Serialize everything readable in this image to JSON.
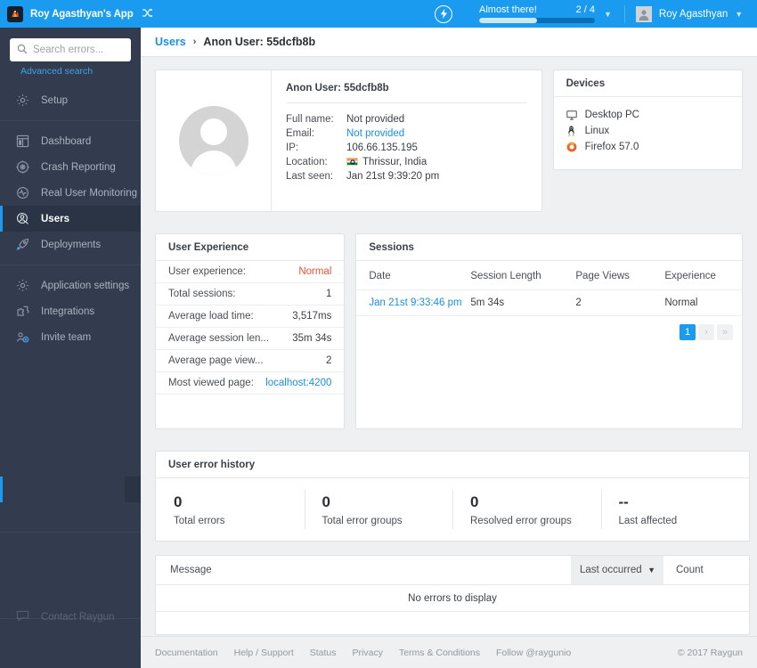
{
  "topbar": {
    "logo_icon": "app-logo-icon",
    "app_name": "Roy Agasthyan's App",
    "switch_icon": "shuffle-icon",
    "bolt_icon": "bolt-circle-icon",
    "onboarding": {
      "label": "Almost there!",
      "count": "2 / 4",
      "progress_percent": 50,
      "caret_icon": "caret-down-icon"
    },
    "user": {
      "avatar_icon": "user-avatar-icon",
      "name": "Roy Agasthyan",
      "caret_icon": "caret-down-icon"
    }
  },
  "sidebar": {
    "search": {
      "icon": "search-icon",
      "placeholder": "Search errors...",
      "value": ""
    },
    "advanced_search": "Advanced search",
    "items": [
      {
        "label": "Setup",
        "icon": "gear-icon",
        "active": false
      },
      {
        "label": "Dashboard",
        "icon": "dashboard-icon",
        "active": false
      },
      {
        "label": "Crash Reporting",
        "icon": "target-icon",
        "active": false
      },
      {
        "label": "Real User Monitoring",
        "icon": "pulse-icon",
        "active": false
      },
      {
        "label": "Users",
        "icon": "user-search-icon",
        "active": true
      },
      {
        "label": "Deployments",
        "icon": "rocket-icon",
        "active": false
      },
      {
        "label": "Application settings",
        "icon": "gear-icon",
        "active": false
      },
      {
        "label": "Integrations",
        "icon": "puzzle-icon",
        "active": false
      },
      {
        "label": "Invite team",
        "icon": "add-user-icon",
        "active": false
      }
    ],
    "contact": {
      "label": "Contact Raygun",
      "icon": "chat-icon"
    }
  },
  "breadcrumb": {
    "parent": "Users",
    "separator": "›",
    "current": "Anon User: 55dcfb8b"
  },
  "profile": {
    "avatar_icon": "placeholder-avatar-icon",
    "title": "Anon User: 55dcfb8b",
    "fields": [
      {
        "key": "Full name:",
        "value": "Not provided",
        "link": false,
        "flag": false
      },
      {
        "key": "Email:",
        "value": "Not provided",
        "link": true,
        "flag": false
      },
      {
        "key": "IP:",
        "value": "106.66.135.195",
        "link": false,
        "flag": false
      },
      {
        "key": "Location:",
        "value": "Thrissur, India",
        "link": false,
        "flag": true
      },
      {
        "key": "Last seen:",
        "value": "Jan 21st 9:39:20 pm",
        "link": false,
        "flag": false
      }
    ]
  },
  "devices": {
    "title": "Devices",
    "items": [
      {
        "label": "Desktop PC",
        "icon": "monitor-icon"
      },
      {
        "label": "Linux",
        "icon": "linux-tux-icon"
      },
      {
        "label": "Firefox 57.0",
        "icon": "firefox-icon"
      }
    ]
  },
  "user_experience": {
    "title": "User Experience",
    "rows": [
      {
        "key": "User experience:",
        "value": "Normal",
        "style": "warn"
      },
      {
        "key": "Total sessions:",
        "value": "1",
        "style": ""
      },
      {
        "key": "Average load time:",
        "value": "3,517ms",
        "style": ""
      },
      {
        "key": "Average session len...",
        "value": "35m 34s",
        "style": ""
      },
      {
        "key": "Average page view...",
        "value": "2",
        "style": ""
      },
      {
        "key": "Most viewed page:",
        "value": "localhost:4200",
        "style": "link"
      }
    ]
  },
  "sessions": {
    "title": "Sessions",
    "columns": [
      "Date",
      "Session Length",
      "Page Views",
      "Experience"
    ],
    "rows": [
      {
        "date": "Jan 21st 9:33:46 pm",
        "length": "5m 34s",
        "views": "2",
        "experience": "Normal"
      }
    ],
    "pagination": {
      "current": "1",
      "next_icon": "›",
      "last_icon": "»"
    }
  },
  "error_history": {
    "title": "User error history",
    "stats": [
      {
        "value": "0",
        "label": "Total errors"
      },
      {
        "value": "0",
        "label": "Total error groups"
      },
      {
        "value": "0",
        "label": "Resolved error groups"
      },
      {
        "value": "--",
        "label": "Last affected"
      }
    ]
  },
  "error_table": {
    "columns": {
      "message": "Message",
      "last_occurred": "Last occurred",
      "sort_icon": "chevron-down-icon",
      "count": "Count"
    },
    "empty_text": "No errors to display"
  },
  "footer": {
    "links": [
      "Documentation",
      "Help / Support",
      "Status",
      "Privacy",
      "Terms & Conditions",
      "Follow @raygunio"
    ],
    "copyright": "© 2017 Raygun"
  },
  "colors": {
    "brand_blue": "#1a9bf0",
    "sidebar_dark": "#333c4e",
    "sidebar_active": "#2b3444",
    "link_blue": "#1a8fe3",
    "warn_orange": "#e8553a",
    "page_bg": "#eff0f1"
  }
}
